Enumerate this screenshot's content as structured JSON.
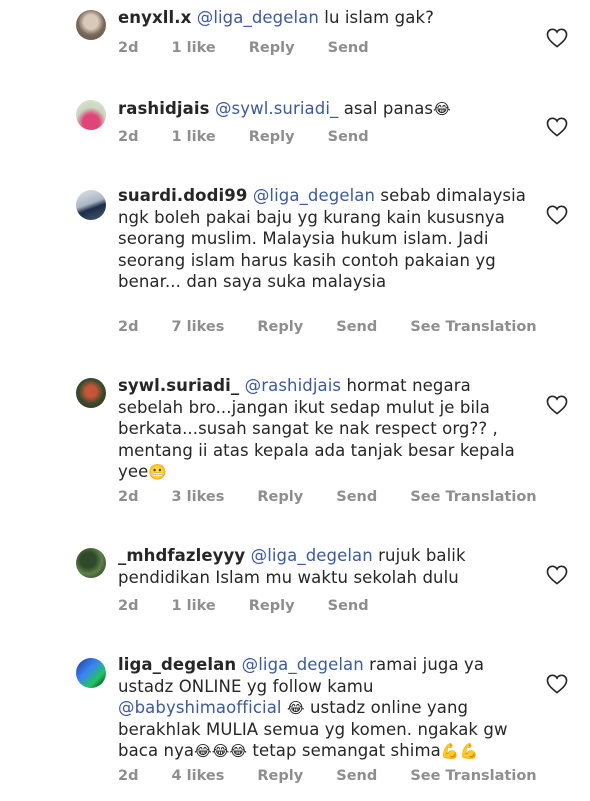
{
  "comments": [
    {
      "username": "enyxll.x",
      "mention": "@liga_degelan",
      "text": " lu islam gak?",
      "time": "2d",
      "likes": "1 like",
      "reply": "Reply",
      "send": "Send",
      "see_translation": ""
    },
    {
      "username": "rashidjais",
      "mention": "@sywl.suriadi_",
      "text": " asal panas",
      "emoji": "😂",
      "time": "2d",
      "likes": "1 like",
      "reply": "Reply",
      "send": "Send",
      "see_translation": ""
    },
    {
      "username": "suardi.dodi99",
      "mention": "@liga_degelan",
      "text": " sebab dimalaysia ngk boleh pakai baju yg kurang kain kususnya seorang muslim. Malaysia hukum islam. Jadi seorang islam harus kasih contoh pakaian yg benar... dan saya suka malaysia",
      "time": "2d",
      "likes": "7 likes",
      "reply": "Reply",
      "send": "Send",
      "see_translation": "See Translation"
    },
    {
      "username": "sywl.suriadi_",
      "mention": "@rashidjais",
      "text": " hormat negara sebelah bro...jangan ikut sedap mulut je bila berkata...susah sangat ke nak respect org?? , mentang ii atas kepala ada tanjak besar kepala yee",
      "emoji": "😬",
      "time": "2d",
      "likes": "3 likes",
      "reply": "Reply",
      "send": "Send",
      "see_translation": "See Translation"
    },
    {
      "username": "_mhdfazleyyy",
      "mention": "@liga_degelan",
      "text": " rujuk balik pendidikan Islam mu waktu sekolah dulu",
      "time": "2d",
      "likes": "1 like",
      "reply": "Reply",
      "send": "Send",
      "see_translation": ""
    },
    {
      "username": "liga_degelan",
      "mention": "@liga_degelan",
      "text": " ramai juga ya ustadz ONLINE yg follow kamu ",
      "mention2": "@babyshimaofficial",
      "emoji_a": "😂",
      "text2": "  ustadz online yang berakhlak MULIA semua yg komen. ngakak gw baca nya",
      "emoji_b": "😂😂😂",
      "text3": " tetap semangat shima",
      "emoji_c": "💪💪",
      "time": "2d",
      "likes": "4 likes",
      "reply": "Reply",
      "send": "Send",
      "see_translation": "See Translation"
    }
  ],
  "icons": {
    "like": "heart-outline-icon"
  },
  "colors": {
    "mention": "#3d5a98",
    "meta": "#8e8e8e",
    "text": "#262626"
  }
}
